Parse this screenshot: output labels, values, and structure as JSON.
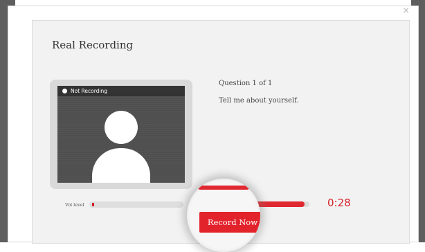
{
  "modal": {
    "title": "Real Recording",
    "close_icon": "×"
  },
  "camera": {
    "status": "Not Recording",
    "placeholder_icon": "user-silhouette-icon"
  },
  "question": {
    "counter": "Question 1 of 1",
    "text": "Tell me about yourself."
  },
  "volume": {
    "label": "Vol level",
    "level_fraction": 0.02
  },
  "timer": {
    "value": "0:28",
    "progress_fraction": 0.93
  },
  "actions": {
    "record_label": "Record Now"
  },
  "colors": {
    "accent_red": "#e3232c",
    "panel_bg": "#f2f2f2",
    "camera_bg": "#4f4f4f"
  }
}
